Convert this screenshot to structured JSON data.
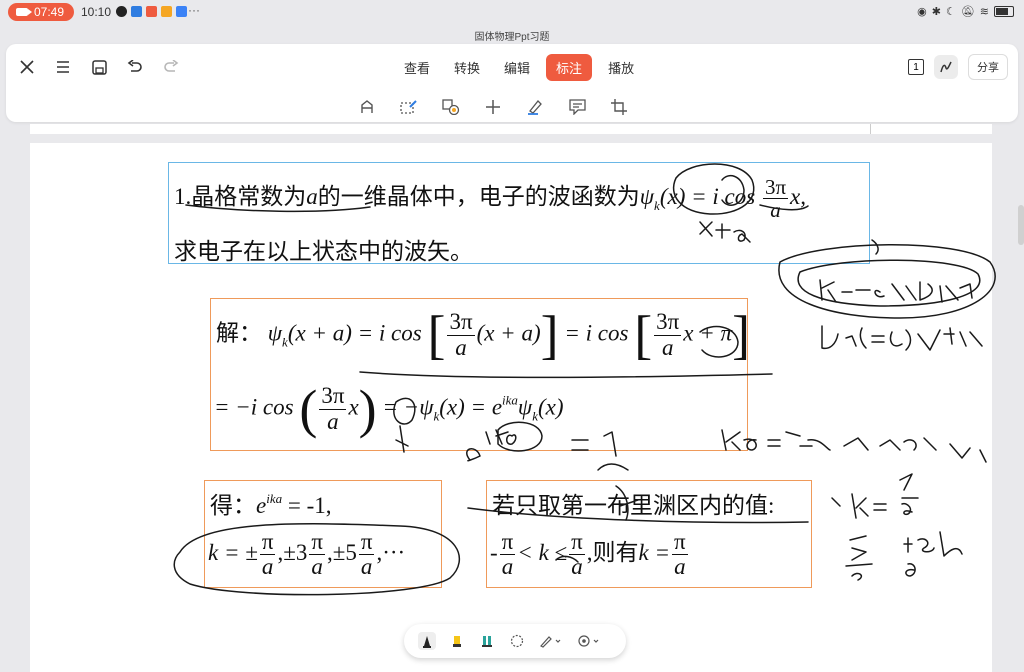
{
  "status_bar": {
    "recording_time": "07:49",
    "clock": "10:10",
    "more": "···",
    "battery": ""
  },
  "doc_title": "固体物理Ppt习题",
  "toolbar": {
    "tabs": [
      {
        "label": "查看",
        "active": false
      },
      {
        "label": "转换",
        "active": false
      },
      {
        "label": "编辑",
        "active": false
      },
      {
        "label": "标注",
        "active": true
      },
      {
        "label": "播放",
        "active": false
      }
    ],
    "page_badge": "1",
    "share_label": "分享",
    "left_icons": [
      "close-icon",
      "menu-icon",
      "save-icon",
      "undo-icon",
      "redo-icon"
    ],
    "annotation_tools": [
      "text-select-icon",
      "shape-edit-icon",
      "shape-icon",
      "plus-icon",
      "highlighter-icon",
      "comment-icon",
      "crop-icon"
    ],
    "accent_color": "#ef5b3f"
  },
  "slide": {
    "question": {
      "line1_a": "1.晶格常数为",
      "line1_a_var": "a",
      "line1_b": "的一维晶体中，电子的波函数为",
      "psi": "ψ",
      "sub_k": "k",
      "arg_x": "(x)",
      "eq": "= i cos",
      "frac_num": "3π",
      "frac_den": "a",
      "tail": "x,",
      "line2": "求电子在以上状态中的波矢。"
    },
    "solution": {
      "label": "解：",
      "l1_psi": "ψ",
      "l1_sub": "k",
      "l1_arg": "(x + a) = i cos",
      "l1_f1_num": "3π",
      "l1_f1_den": "a",
      "l1_mid": "(x + a)",
      "l1_eq2": "= i cos",
      "l1_f2_num": "3π",
      "l1_f2_den": "a",
      "l1_tail": "x + π",
      "l2_head": "= −i cos",
      "l2_f_num": "3π",
      "l2_f_den": "a",
      "l2_x": "x",
      "l2_mid": "= −ψ",
      "l2_sub": "k",
      "l2_arg": "(x) = e",
      "l2_sup": "ika",
      "l2_psi": "ψ",
      "l2_sub2": "k",
      "l2_end": "(x)"
    },
    "result": {
      "label": "得：",
      "e": "e",
      "sup": "ika",
      "eq": " = -1,",
      "k": "k = ±",
      "f1_num": "π",
      "f1_den": "a",
      "mid1": ",±3",
      "f2_num": "π",
      "f2_den": "a",
      "mid2": ",±5",
      "f3_num": "π",
      "f3_den": "a",
      "end": ",···"
    },
    "brillouin": {
      "title": "若只取第一布里渊区内的值:",
      "neg": "-",
      "f1_num": "π",
      "f1_den": "a",
      "ineq": "< k ≤",
      "f2_num": "π",
      "f2_den": "a",
      "then": ",则有",
      "k_eq": "k =",
      "f3_num": "π",
      "f3_den": "a"
    }
  },
  "bottom_bar": {
    "tools": [
      "pen-icon",
      "highlighter-icon",
      "marker-icon",
      "lasso-icon",
      "pencil-dropdown-icon",
      "eraser-dropdown-icon"
    ]
  }
}
